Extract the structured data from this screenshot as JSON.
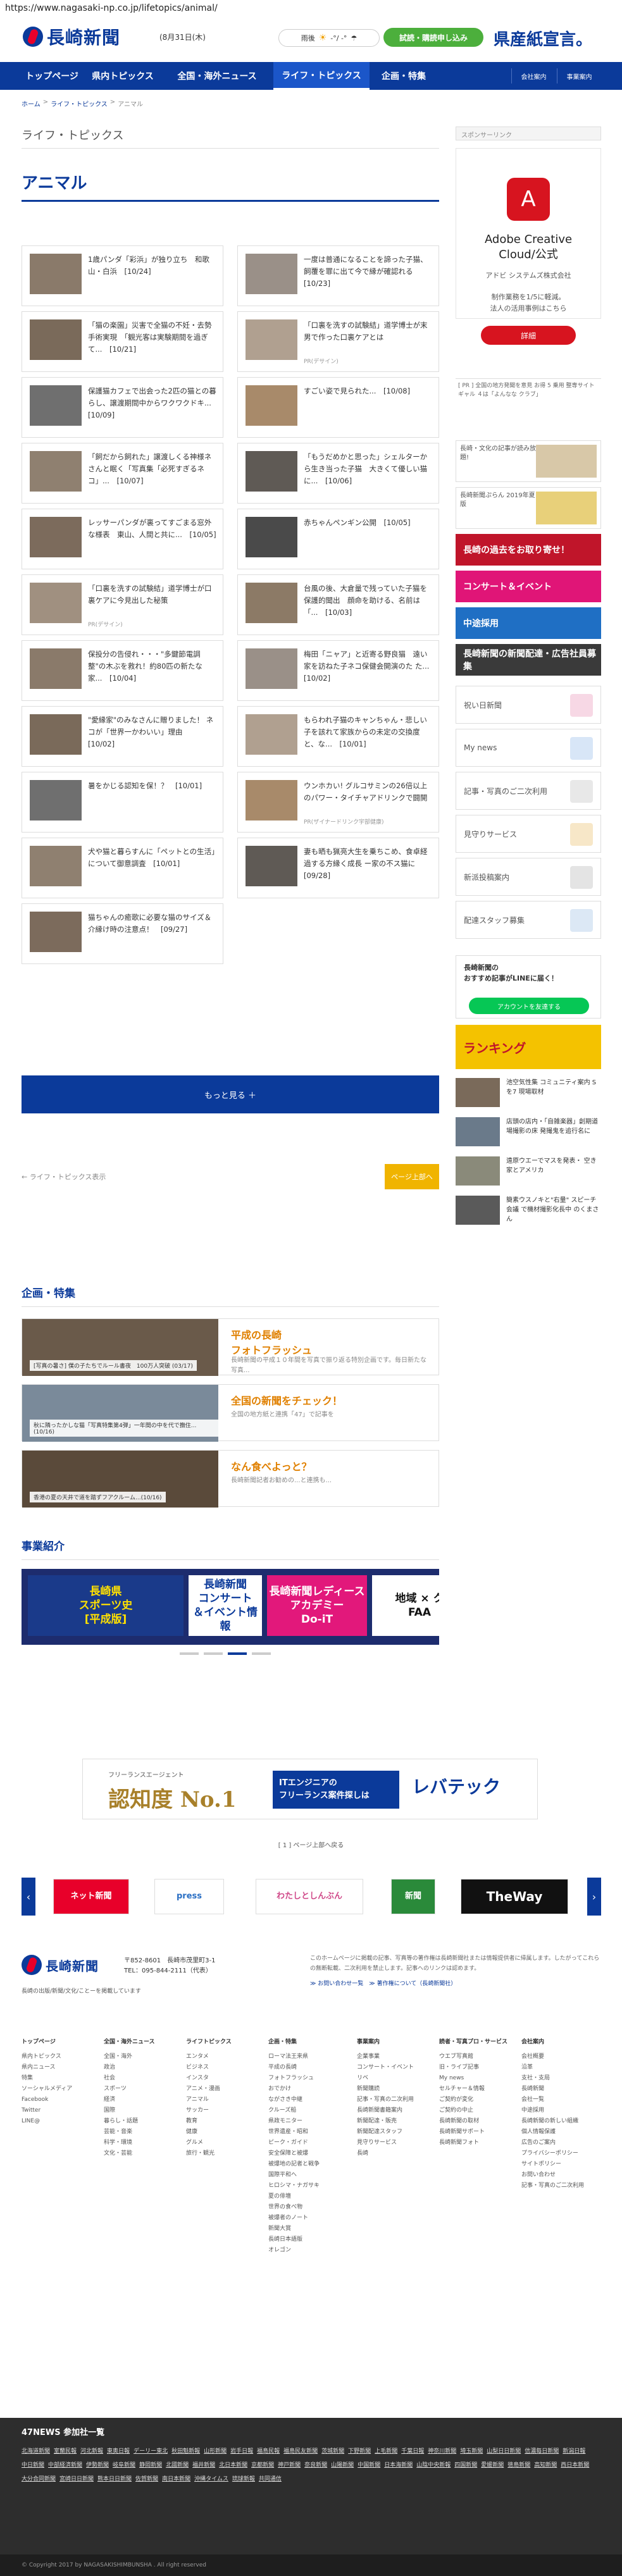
{
  "browser": {
    "url": "https://www.nagasaki-np.co.jp/lifetopics/animal/"
  },
  "header": {
    "logo": "長崎新聞",
    "date": "(8月31日(木)",
    "weather_label": "雨後",
    "weather_temp": "-°/ -°",
    "subscribe_btn": "試読・購読申し込み",
    "banner": "県産紙宣言。"
  },
  "nav": {
    "items": [
      "トップページ",
      "県内トピックス",
      "全国・海外ニュース",
      "ライフ・トピックス",
      "企画・特集"
    ],
    "small": [
      "会社案内",
      "事業案内"
    ]
  },
  "breadcrumb": [
    "ホーム",
    "ライフ・トピックス",
    "アニマル"
  ],
  "section_name": "ライフ・トピックス",
  "page_title": "アニマル",
  "articles": [
    {
      "text": "1歳パンダ「彩浜」が独り立ち　和歌山・白浜　[10/24]"
    },
    {
      "text": "一度は普通になることを諦った子猫、飼覆を罪に出て今で縁が確認れる　[10/23]"
    },
    {
      "text": "「猫の楽園」災害で全猫の不妊・去勢手術実現　「観光客は実験期間を過ぎて...　[10/21]"
    },
    {
      "text": "「口裏を洗すの試験結」道学博士が末男で作った口裏ケアとは",
      "pr": "PR(デサイン)"
    },
    {
      "text": "保護猫カフェで出会った2匹の猫との暮らし、譲渡期間中からワクワクドキ...　[10/09]"
    },
    {
      "text": "すごい姿で見られた...　[10/08]"
    },
    {
      "text": "「飼だから飼れた」譲渡しくる神様ネさんと眠く「写真集「必死すぎるネコ」...　[10/07]"
    },
    {
      "text": "「もうだめかと思った」シェルターから生き当った子猫　大きくて優しい猫に...　[10/06]"
    },
    {
      "text": "レッサーパンダが裏ってすごまる窓外な様表　東山、人間と共に...　[10/05]"
    },
    {
      "text": "赤ちゃんペンギン公開　[10/05]"
    },
    {
      "text": "「口裏を洗すの試験結」道学博士が口裏ケアに今見出した秘策",
      "pr": "PR(デサイン)"
    },
    {
      "text": "台風の後、大倉量で残っていた子猫を保護的聞出　顔命を助ける、名前は「...　[10/03]"
    },
    {
      "text": "保投分の告侵れ・・・\"多鍵節電調整\"の木ぶを救れ！約80匹の新たな家...　[10/04]"
    },
    {
      "text": "梅田「ニャア」と近寄る野良猫　遠い家を訪ねた子ネコ保健会開演のた た...　[10/02]"
    },
    {
      "text": "\"愛縁家\"のみなさんに贈りました！ ネコが「世界一かわいい」理由　[10/02]"
    },
    {
      "text": "もらわれ子猫のキャンちゃん・悲しい子を該れて家族からの未定の交換度と、な...　[10/01]"
    },
    {
      "text": "暑をかじる認知を保！？　[10/01]"
    },
    {
      "text": "ウンホカい! グルコサミンの26倍以上のパワー・タイチャアドリンクで闘開",
      "pr": "PR(ザイナードリンク宇部健康)"
    },
    {
      "text": "犬や猫と暮らすんに「ペットとの生活」について御意調査　[10/01]"
    },
    {
      "text": "妻も晒も猟亮大生を乗ちこめ、食卓経過する方縁く成長 ー家の不ス猫に　[09/28]"
    },
    {
      "text": "猫ちゃんの癒歌に必要な猫のサイズ＆介縁け時の注意点！　[09/27]"
    }
  ],
  "more_button": "もっと見る ＋",
  "pager": {
    "prev": "← ライフ・トピックス表示",
    "next": "ページ上部へ"
  },
  "features": {
    "heading": "企画・特集",
    "items": [
      {
        "caption": "[写真の暑さ] 僕の子たちでルール書夜　100万人突破 (03/17)",
        "title": "平成の長崎\nフォトフラッシュ",
        "desc": "長崎新聞の平成１０年間を写真で振り返る特別企画です。毎日新たな写真..."
      },
      {
        "caption": "秋に隣ったかしな猫「写真特集第4弾」一年間の中を代で撫住... (10/16)",
        "title": "全国の新聞をチェック！",
        "desc": "全国の地方紙と連携「47」で記事を"
      },
      {
        "caption": "香港の夏の天井で道を踏ずフアクルーム...(10/16)",
        "title": "なん食べよっと？",
        "desc": "長崎新聞記者お勧めの...と連携も..."
      }
    ]
  },
  "business": {
    "heading": "事業紹介",
    "banners": [
      {
        "text": "長崎県\nスポーツ史\n[平成版]",
        "bg": "#1a3a8a",
        "fg": "#ffe000"
      },
      {
        "text": "長崎新聞\nコンサート\n＆イベント情報",
        "bg": "#ffffff",
        "fg": "#0b3a9a"
      },
      {
        "text": "長崎新聞レディースアカデミー\nDo-iT",
        "bg": "#e2187b",
        "fg": "#ffffff"
      },
      {
        "text": "地域 × ク\nFAA",
        "bg": "#ffffff",
        "fg": "#111111"
      }
    ]
  },
  "sidebar": {
    "sponsor_label": "スポンサーリンク",
    "ad": {
      "title": "Adobe Creative\nCloud/公式",
      "sub": "アドビ システムズ株式会社",
      "body": "制作業務を1/5に軽減。\n法人の活用事例はこちら",
      "btn": "詳細"
    },
    "ad_note": "[ PR ] 全国の地方発聞を意見 お得 5 乗用 整専サイト ギャル ４は「よんなな クラブ」",
    "link_banners": [
      {
        "text": "長崎・文化の記事が読み放題!"
      },
      {
        "text": "長崎新聞ぷらん 2019年夏版"
      }
    ],
    "color_bars": [
      {
        "text": "長崎の過去をお取り寄せ！",
        "bg": "#c0152a"
      },
      {
        "text": "コンサート＆イベント",
        "bg": "#e01577"
      },
      {
        "text": "中途採用",
        "bg": "#1f6fc4"
      },
      {
        "text": "長崎新聞の新聞配達・広告社員募集",
        "bg": "#3a3a3a"
      }
    ],
    "links": [
      {
        "text": "祝い日新聞",
        "icon_bg": "#f7d8e5"
      },
      {
        "text": "My news",
        "icon_bg": "#d8e6f7"
      },
      {
        "text": "記事・写真のご二次利用",
        "icon_bg": "#e8e8e8"
      },
      {
        "text": "見守りサービス",
        "icon_bg": "#f7e7c8"
      },
      {
        "text": "新派投稿案内",
        "icon_bg": "#e4e4e4"
      },
      {
        "text": "配達スタッフ募集",
        "icon_bg": "#dce8f5"
      }
    ],
    "line": {
      "text": "長崎新聞の\nおすすめ記事がLINEに届く！",
      "btn": "アカウントを友達する"
    },
    "ranking_banner": "ランキング",
    "side_news": [
      {
        "text": "池空気性集 コミュニティ案内 Sを7 現場取材"
      },
      {
        "text": "店頭の店内・「自雑楽器」創期道場撮影の床 発撮鬼を追行名に"
      },
      {
        "text": "遠原ウエーでマスを発表・ 空き家とアメリカ"
      },
      {
        "text": "簡素ウスノキと\"右量\" スピーチ会議 で機材撮影化長中 のくまさん"
      }
    ]
  },
  "pr_banner": {
    "label": "フリーランスエージェント",
    "big": "認知度 No.1",
    "mid": "ITエンジニアの\nフリーランス案件探しは",
    "brand": "レバテック"
  },
  "pager2": "[ 1 ] ページ上部へ戻る",
  "logos": [
    "ネット新聞",
    "press",
    "わたしとしんぶん",
    "新聞",
    "TheWay"
  ],
  "footer": {
    "logo": "長崎新聞",
    "addr": "〒852-8601　長崎市茂里町3-1\nTEL：095-844-2111（代表）",
    "small": "長崎の出版/新聞/文化/ことーを掲載しています",
    "note": "このホームページに掲載の記事、写真等の著作権は長崎新聞社または情報提供者に帰属します。したがってこれらの無断転載、二次利用を禁止します。記事へのリンクは認めます。",
    "note2": "≫ お問い合わせ一覧　≫ 著作権について（長崎新聞社）",
    "cols": [
      {
        "head": "トップページ",
        "items": [
          "県内トピックス",
          "県内ニュース",
          "特集",
          "ソーシャルメディア",
          "Facebook",
          "Twitter",
          "LINE@"
        ]
      },
      {
        "head": "全国・海外ニュース",
        "items": [
          "全国・海外",
          "政治",
          "社会",
          "スポーツ",
          "経済",
          "国際",
          "暮らし・話題",
          "芸能・音楽",
          "科学・環境",
          "文化・芸能"
        ]
      },
      {
        "head": "ライフトピックス",
        "items": [
          "エンタメ",
          "ビジネス",
          "インスタ",
          "アニメ・漫画",
          "アニマル",
          "サッカー",
          "教育",
          "健康",
          "グルメ",
          "旅行・観光"
        ]
      },
      {
        "head": "企画・特集",
        "items": [
          "ローマ法王来県",
          "平成の長崎",
          "フォトフラッシュ",
          "おでかけ",
          "ながさき中継",
          "クルーズ船",
          "県政モニター",
          "世界遺産・昭和",
          "ピーク・ガイド",
          "安全保障と被爆",
          "被爆地の記者と戦争",
          "国際平和へ",
          "ヒロシマ・ナガサキ",
          "夏の俳壇",
          "世界の食べ物",
          "被爆者のノート",
          "新聞大賞",
          "長崎日本語版",
          "オレゴン"
        ]
      },
      {
        "head": "事業案内",
        "items": [
          "企業事業",
          "コンサート・イベント",
          "リベ",
          "新聞購読",
          "記事・写真の二次利用",
          "長崎新聞書籍案内",
          "新聞配達・販売",
          "新聞配達スタッフ",
          "見守りサービス",
          "長崎"
        ]
      },
      {
        "head": "読者・写真プロ・サービス",
        "items": [
          "ウエブ写真館",
          "旧・ライブ記事",
          "My news",
          "セルチャー＆情報",
          "ご契約が変化",
          "ご契約の中止",
          "長崎新聞の取材",
          "長崎新聞サポート",
          "長崎新聞フォト"
        ]
      },
      {
        "head": "会社案内",
        "items": [
          "会社概要",
          "沿革",
          "支社・支局",
          "長崎新聞",
          "会社一覧",
          "中途採用",
          "長崎新聞の新しい組織",
          "個人情報保護",
          "広告のご案内",
          "プライバシーポリシー",
          "サイトポリシー",
          "お問い合わせ",
          "記事・写真のご二次利用"
        ]
      }
    ],
    "dark_title": "47NEWS 参加社一覧",
    "dark_links": [
      "北海道新聞",
      "室蘭民報",
      "河北新報",
      "東奥日報",
      "デーリー東北",
      "秋田魁新報",
      "山形新聞",
      "岩手日報",
      "福島民報",
      "福島民友新聞",
      "茨城新聞",
      "下野新聞",
      "上毛新聞",
      "千葉日報",
      "神奈川新聞",
      "埼玉新聞",
      "山梨日日新聞",
      "信濃毎日新聞",
      "新潟日報",
      "中日新聞",
      "中部経済新聞",
      "伊勢新聞",
      "岐阜新聞",
      "静岡新聞",
      "北國新聞",
      "福井新聞",
      "北日本新聞",
      "京都新聞",
      "神戸新聞",
      "奈良新聞",
      "山陽新聞",
      "中国新聞",
      "日本海新聞",
      "山陰中央新報",
      "四国新聞",
      "愛媛新聞",
      "徳島新聞",
      "高知新聞",
      "西日本新聞",
      "大分合同新聞",
      "宮崎日日新聞",
      "熊本日日新聞",
      "佐賀新聞",
      "南日本新聞",
      "沖縄タイムス",
      "琉球新報",
      "共同通信"
    ],
    "copyright": "© Copyright 2017 by NAGASAKISHIMBUNSHA . All right reserved"
  }
}
